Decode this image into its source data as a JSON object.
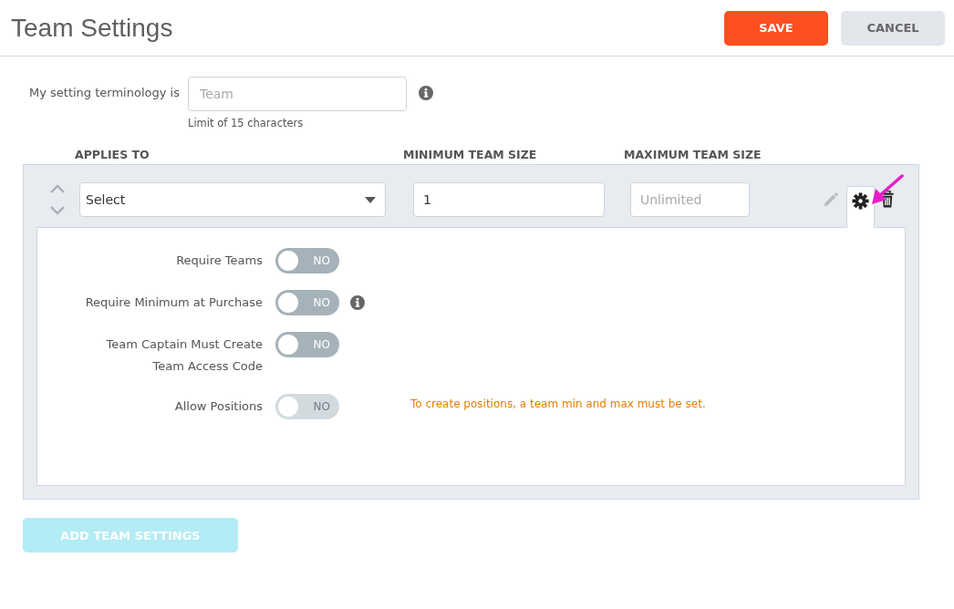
{
  "header": {
    "title": "Team Settings",
    "buttons": [
      {
        "label": "SAVE",
        "kind": "primary"
      },
      {
        "label": "CANCEL",
        "kind": "secondary"
      }
    ]
  },
  "terminology": {
    "label": "My setting terminology is",
    "placeholder": "Team",
    "hint": "Limit of 15 characters"
  },
  "columns": [
    "APPLIES TO",
    "MINIMUM TEAM SIZE",
    "MAXIMUM TEAM SIZE"
  ],
  "setting": {
    "applies_to": "Select",
    "min_size": "1",
    "max_placeholder": "Unlimited",
    "settings_expanded": true,
    "options": [
      {
        "label": "Require Teams",
        "on": false,
        "disabled": false,
        "state_text": "NO",
        "info": false
      },
      {
        "label": "Require Minimum at Purchase",
        "on": false,
        "disabled": false,
        "state_text": "NO",
        "info": true
      },
      {
        "label": "Team Captain Must Create\nTeam Access Code",
        "on": false,
        "disabled": false,
        "state_text": "NO",
        "info": false
      },
      {
        "label": "Allow Positions",
        "on": false,
        "disabled": true,
        "state_text": "NO",
        "info": false,
        "note": "To create positions, a team min and max must be set."
      }
    ]
  },
  "add_button": {
    "label": "ADD TEAM SETTINGS",
    "disabled": true
  }
}
